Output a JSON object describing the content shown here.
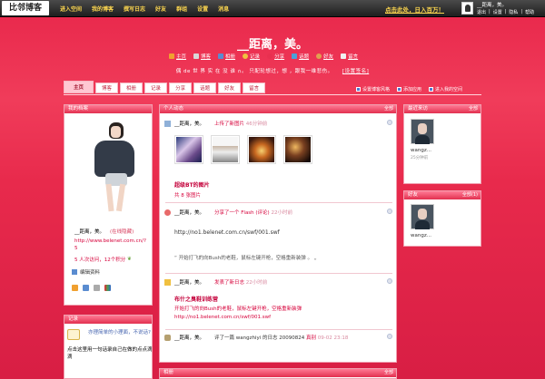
{
  "topbar": {
    "logo": "比邻博客",
    "nav": [
      "进入空间",
      "我的博客",
      "撰写日志",
      "好友",
      "群组",
      "设置",
      "消息"
    ],
    "promo": "点击此处，日入百万！",
    "user": "__距离，美。",
    "links": [
      "退出",
      "设置",
      "隐私",
      "帮助"
    ]
  },
  "header": {
    "title": "__距离，美。",
    "nav": [
      {
        "label": "主页",
        "color": "#f0a030"
      },
      {
        "label": "博客",
        "color": "#d8d8d8"
      },
      {
        "label": "相册",
        "color": "#5a8cd0"
      },
      {
        "label": "记录",
        "color": "#f0c040"
      },
      {
        "label": "分享",
        "color": "#e83050"
      },
      {
        "label": "话题",
        "color": "#4aa0d8"
      },
      {
        "label": "好友",
        "color": "#e0a050"
      },
      {
        "label": "留言",
        "color": "#f0f0f0"
      }
    ],
    "motto": "偶 de 世 界 实 在 没 谁 ∩。 只配轮想过，想 ，跟我一维悲伤。",
    "motto_set": "[设置签名]"
  },
  "tabs": [
    "主页",
    "博客",
    "相册",
    "记录",
    "分享",
    "话题",
    "好友",
    "留言"
  ],
  "tab_links": [
    "设置博客风格",
    "添加应用",
    "进入我的空间"
  ],
  "profile": {
    "header": "我的档案",
    "name": "__距离，美。",
    "name_sub": "(在线隐藏)",
    "url": "http://www.belenet.com.cn/?5",
    "stats": "5 人次访问，12个积分",
    "edit": "编辑资料",
    "icon_colors": [
      "#f0a030",
      "#5a8cd0",
      "#aaaaaa",
      "#4aa050"
    ]
  },
  "record": {
    "header": "记录",
    "t1": "亦理简单的小理面，不说话?",
    "t2": "点击这里用一句话录自己在做的点点滴滴"
  },
  "feed": {
    "header": "个人动态",
    "more": "全部",
    "items": [
      {
        "user": "__距离，美。",
        "action": "上传了新图片",
        "time": "46分钟前",
        "title": "超级BT的图片",
        "count": "共 8 张图片"
      },
      {
        "user": "__距离，美。",
        "action": "分享了一个 Flash (评论)",
        "time": "22小时前",
        "url": "http://no1.belenet.com.cn/swf/001.swf",
        "quote": "开始打飞的向Bush的老鞋，鼠标左键开枪，空格重新装弹 。"
      },
      {
        "user": "__距离，美。",
        "action": "发表了新日志",
        "time": "22小时前",
        "title": "布什之臭鞋训练营",
        "body": "开始打飞的向Bush的老鞋，鼠标左键开枪，空格重新装弹 http://no1.belenet.com.cn/swf/001.swf"
      },
      {
        "user": "__距离，美。",
        "action": "评了一篇 wangzhiyi 的日志 20090824",
        "time": "09-02 23:18",
        "extra": "真别"
      }
    ]
  },
  "album": {
    "header": "相册",
    "more": "全部"
  },
  "visitors": {
    "header": "最近来访",
    "more": "全部",
    "name": "wangz...",
    "time": "25分钟前"
  },
  "friends": {
    "header": "好友",
    "more": "全部(1)",
    "name": "wangz..."
  }
}
